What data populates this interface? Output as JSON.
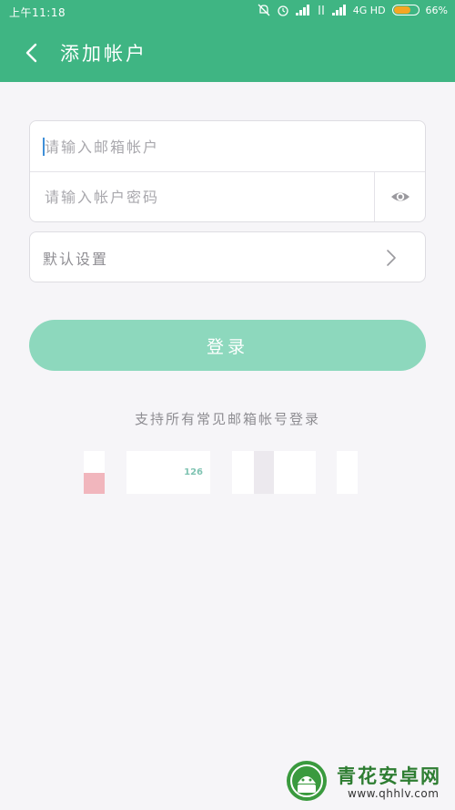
{
  "status_bar": {
    "time": "上午11:18",
    "network": "4G HD",
    "battery": "66%",
    "battery_fraction": 0.66
  },
  "header": {
    "title": "添加帐户"
  },
  "form": {
    "email_placeholder": "请输入邮箱帐户",
    "password_placeholder": "请输入帐户密码",
    "settings_label": "默认设置",
    "login_label": "登录"
  },
  "support": {
    "text": "支持所有常见邮箱帐号登录",
    "providers": [
      {
        "label": ""
      },
      {
        "label": "126"
      },
      {
        "label": ""
      },
      {
        "label": ""
      }
    ]
  },
  "watermark": {
    "title": "青花安卓网",
    "url": "www.qhhlv.com"
  },
  "colors": {
    "brand": "#3fb583",
    "button": "#8dd8bd",
    "background": "#f6f5f8"
  },
  "icons": [
    "back-arrow-icon",
    "eye-icon",
    "chevron-right-icon",
    "mute-icon",
    "alarm-icon",
    "signal-icon",
    "battery-icon"
  ]
}
